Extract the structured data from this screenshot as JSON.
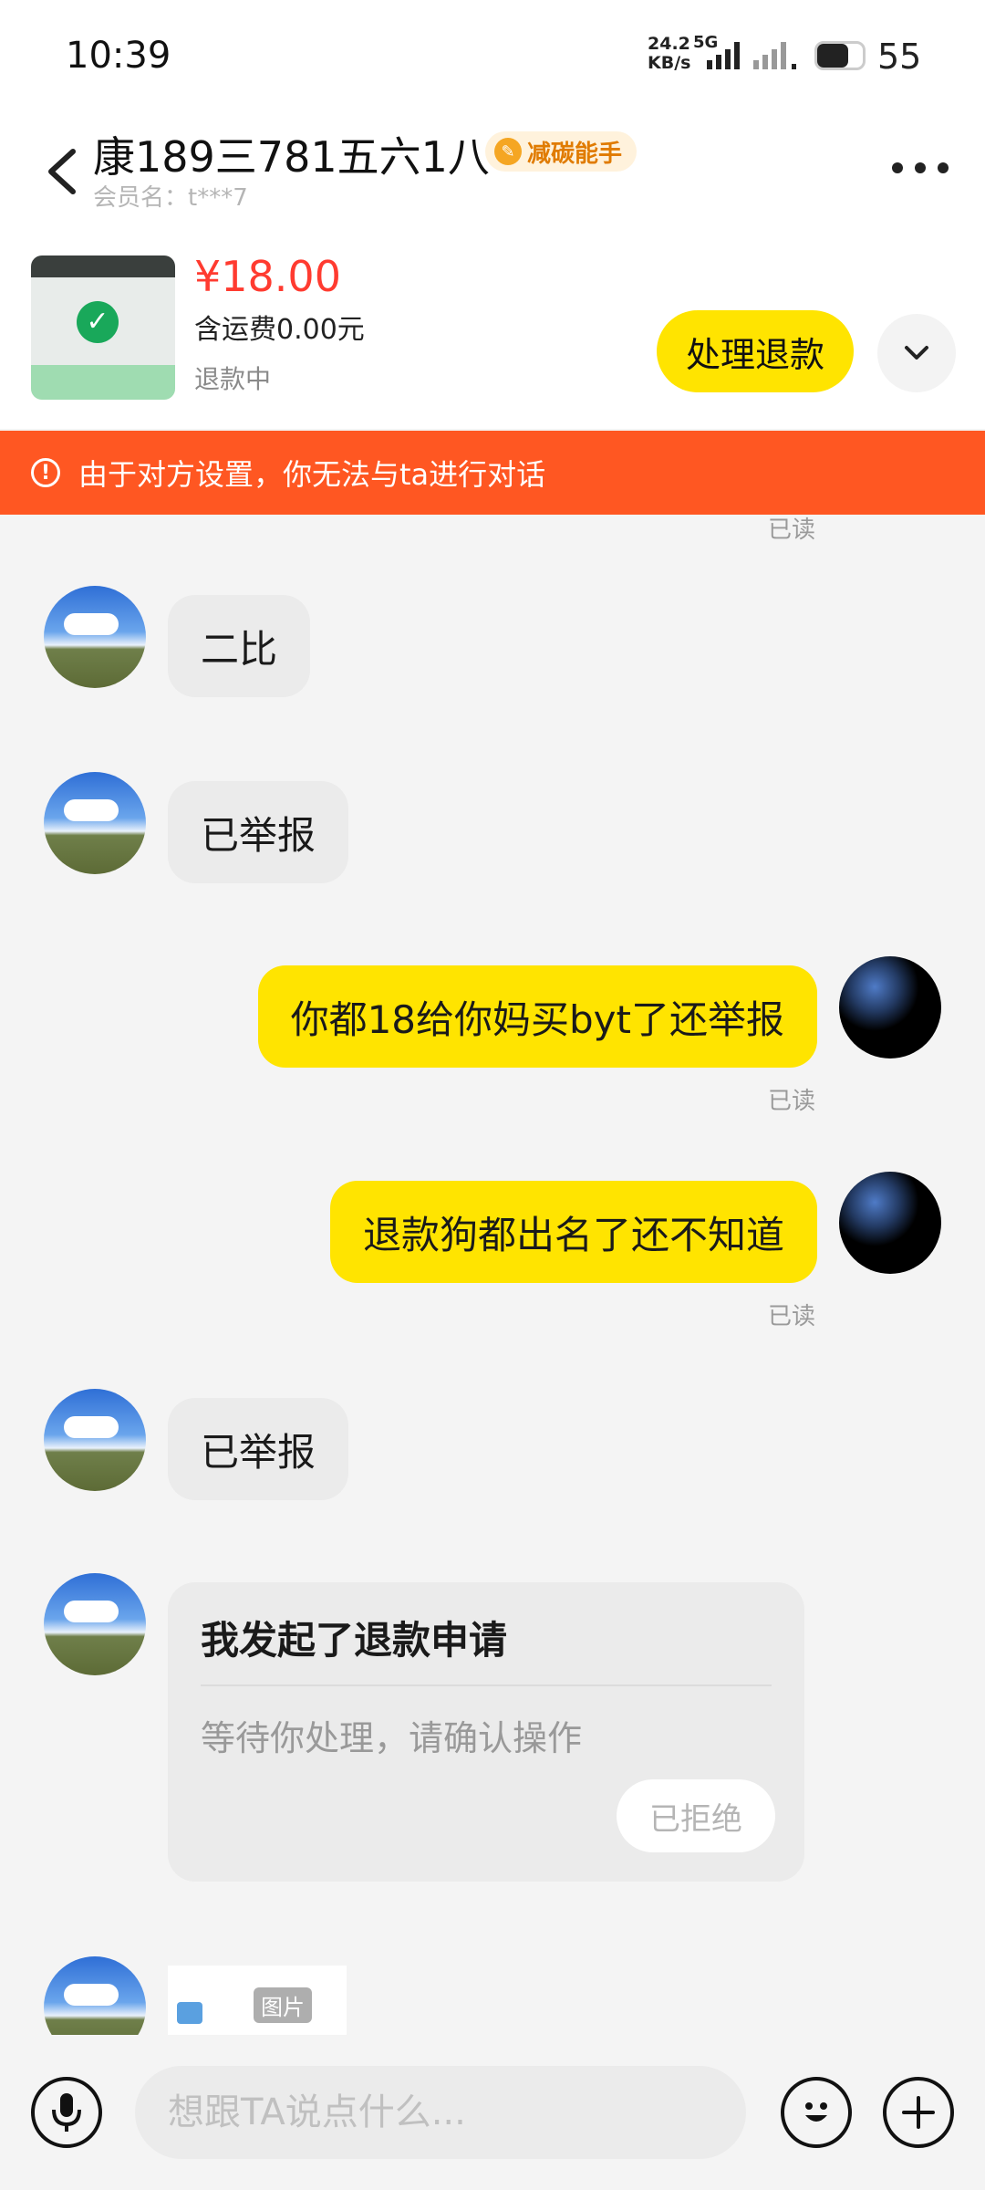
{
  "status_bar": {
    "time": "10:39",
    "net_speed_value": "24.2",
    "net_speed_unit": "KB/s",
    "network": "5G",
    "battery": "55"
  },
  "header": {
    "title": "康189三781五六1八",
    "badge": "减碳能手",
    "member": "会员名：t***7"
  },
  "order": {
    "price": "¥18.00",
    "shipping": "含运费0.00元",
    "status": "退款中",
    "refund_button": "处理退款"
  },
  "banner": {
    "message": "由于对方设置，你无法与ta进行对话"
  },
  "messages": [
    {
      "side": "in",
      "text": "二比"
    },
    {
      "side": "in",
      "text": "已举报"
    },
    {
      "side": "out",
      "text": "你都18给你妈买byt了还举报",
      "read": "已读"
    },
    {
      "side": "out",
      "text": "退款狗都出名了还不知道",
      "read": "已读"
    },
    {
      "side": "in",
      "text": "已举报"
    }
  ],
  "truncated_read": "已读",
  "refund_card": {
    "title": "我发起了退款申请",
    "desc": "等待你处理，请确认操作",
    "button": "已拒绝"
  },
  "image_message": {
    "label": "图片"
  },
  "input": {
    "placeholder": "想跟TA说点什么..."
  },
  "colors": {
    "accent_yellow": "#ffe400",
    "banner_orange": "#ff5722",
    "price_red": "#ff3b30"
  }
}
